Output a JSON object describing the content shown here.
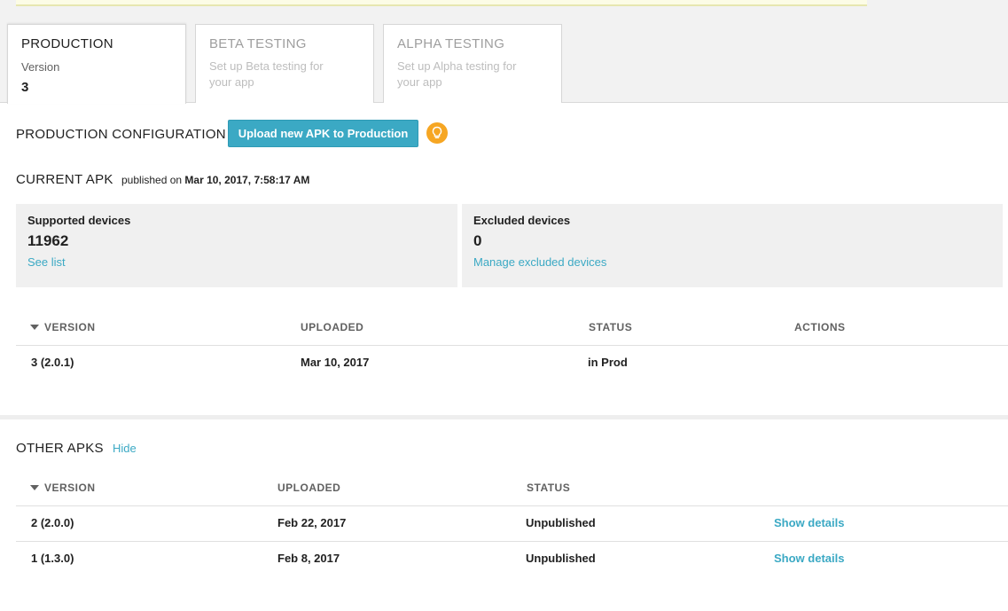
{
  "tabs": [
    {
      "title": "PRODUCTION",
      "subtitle": "Version",
      "value": "3"
    },
    {
      "title": "BETA TESTING",
      "subtitle": "Set up Beta testing for your app"
    },
    {
      "title": "ALPHA TESTING",
      "subtitle": "Set up Alpha testing for your app"
    }
  ],
  "config": {
    "title": "PRODUCTION CONFIGURATION",
    "upload_label": "Upload new APK to Production",
    "tip_icon": "lightbulb-icon"
  },
  "current_apk": {
    "title": "CURRENT APK",
    "published_prefix": "published on",
    "published_date": "Mar 10, 2017, 7:58:17 AM"
  },
  "devices": {
    "supported": {
      "label": "Supported devices",
      "count": "11962",
      "link": "See list"
    },
    "excluded": {
      "label": "Excluded devices",
      "count": "0",
      "link": "Manage excluded devices"
    }
  },
  "current_table": {
    "headers": [
      "VERSION",
      "UPLOADED",
      "STATUS",
      "ACTIONS"
    ],
    "rows": [
      {
        "version": "3 (2.0.1)",
        "uploaded": "Mar 10, 2017",
        "status": "in Prod"
      }
    ]
  },
  "other_apks": {
    "title": "OTHER APKS",
    "hide_label": "Hide",
    "headers": [
      "VERSION",
      "UPLOADED",
      "STATUS"
    ],
    "rows": [
      {
        "version": "2 (2.0.0)",
        "uploaded": "Feb 22, 2017",
        "status": "Unpublished",
        "action": "Show details"
      },
      {
        "version": "1 (1.3.0)",
        "uploaded": "Feb 8, 2017",
        "status": "Unpublished",
        "action": "Show details"
      }
    ]
  },
  "colors": {
    "accent": "#3ba9c4",
    "tip": "#f6a623"
  }
}
